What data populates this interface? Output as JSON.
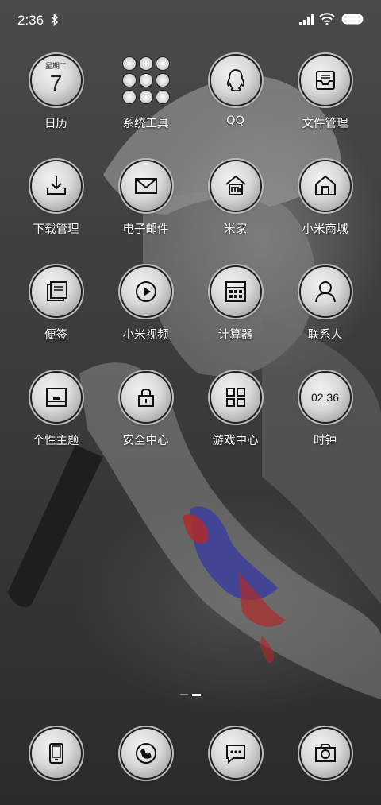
{
  "status_bar": {
    "time": "2:36",
    "icons": [
      "bluetooth-icon",
      "signal-icon",
      "wifi-icon",
      "battery-icon"
    ]
  },
  "apps": [
    [
      {
        "name": "calendar",
        "label": "日历",
        "icon": "calendar-icon",
        "week": "星期二",
        "day": "7"
      },
      {
        "name": "system-tools",
        "label": "系统工具",
        "icon": "tools-folder-icon"
      },
      {
        "name": "qq",
        "label": "QQ",
        "icon": "qq-penguin-icon"
      },
      {
        "name": "file-manager",
        "label": "文件管理",
        "icon": "inbox-tray-icon"
      }
    ],
    [
      {
        "name": "download-manager",
        "label": "下载管理",
        "icon": "download-icon"
      },
      {
        "name": "email",
        "label": "电子邮件",
        "icon": "envelope-icon"
      },
      {
        "name": "mijia",
        "label": "米家",
        "icon": "mi-home-icon"
      },
      {
        "name": "mi-store",
        "label": "小米商城",
        "icon": "store-house-icon"
      }
    ],
    [
      {
        "name": "notes",
        "label": "便签",
        "icon": "notes-icon"
      },
      {
        "name": "mi-video",
        "label": "小米视频",
        "icon": "play-icon"
      },
      {
        "name": "calculator",
        "label": "计算器",
        "icon": "calculator-icon"
      },
      {
        "name": "contacts",
        "label": "联系人",
        "icon": "person-icon"
      }
    ],
    [
      {
        "name": "themes",
        "label": "个性主题",
        "icon": "theme-icon"
      },
      {
        "name": "security",
        "label": "安全中心",
        "icon": "lock-icon"
      },
      {
        "name": "game-center",
        "label": "游戏中心",
        "icon": "grid-icon"
      },
      {
        "name": "clock",
        "label": "时钟",
        "icon": "clock-icon",
        "time": "02:36"
      }
    ]
  ],
  "dock": [
    {
      "name": "phone",
      "icon": "phone-icon"
    },
    {
      "name": "browser",
      "icon": "browser-icon"
    },
    {
      "name": "messages",
      "icon": "chat-bubble-icon"
    },
    {
      "name": "camera",
      "icon": "camera-icon"
    }
  ],
  "page_indicator": {
    "pages": 2,
    "current": 2
  }
}
